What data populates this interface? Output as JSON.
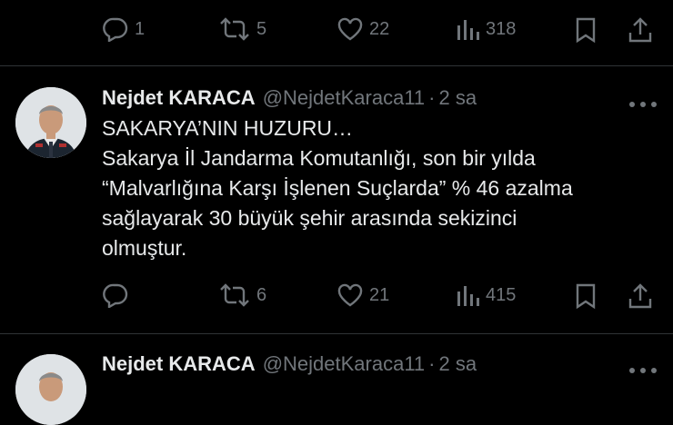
{
  "top_actions": {
    "replies": "1",
    "retweets": "5",
    "likes": "22",
    "views": "318"
  },
  "tweet1": {
    "name": "Nejdet KARACA",
    "handle": "@NejdetKaraca11",
    "separator": "·",
    "time": "2 sa",
    "lines": [
      "SAKARYA’NIN HUZURU…",
      "Sakarya İl Jandarma Komutanlığı, son bir yılda",
      "“Malvarlığına Karşı İşlenen Suçlarda” % 46 azalma",
      "sağlayarak 30 büyük şehir arasında sekizinci",
      "olmuştur."
    ],
    "actions": {
      "replies": "",
      "retweets": "6",
      "likes": "21",
      "views": "415"
    }
  },
  "tweet2": {
    "name": "Nejdet KARACA",
    "handle": "@NejdetKaraca11",
    "separator": "·",
    "time": "2 sa"
  },
  "icons": {
    "reply": "reply-icon",
    "retweet": "retweet-icon",
    "like": "heart-icon",
    "views": "views-icon",
    "bookmark": "bookmark-icon",
    "share": "share-icon",
    "more": "more-icon"
  },
  "colors": {
    "background": "#000000",
    "text": "#e7e9ea",
    "secondary": "#71767b",
    "divider": "#2f3336"
  }
}
